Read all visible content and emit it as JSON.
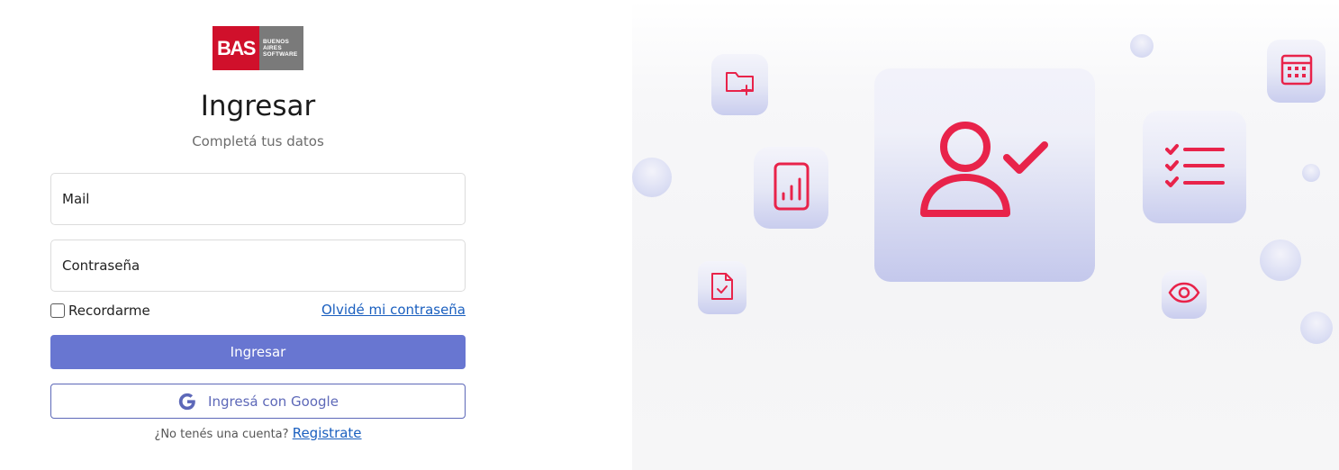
{
  "logo": {
    "mark": "BAS",
    "lines": [
      "BUENOS",
      "AIRES",
      "SOFTWARE"
    ]
  },
  "login": {
    "title": "Ingresar",
    "subtitle": "Completá tus datos",
    "mail_label": "Mail",
    "password_label": "Contraseña",
    "remember_label": "Recordarme",
    "forgot_label": "Olvidé mi contraseña",
    "submit_label": "Ingresar",
    "google_label": "Ingresá con Google",
    "signup_prompt": "¿No tenés una cuenta?",
    "signup_link": "Registrate"
  },
  "colors": {
    "brand_red": "#d0102b",
    "primary": "#6876d1",
    "icon_red": "#e8234a",
    "link": "#1a5fbf"
  },
  "illustration": {
    "icons": [
      "folder-add-icon",
      "bar-chart-document-icon",
      "document-check-icon",
      "user-check-icon",
      "checklist-icon",
      "calendar-icon",
      "eye-icon"
    ]
  }
}
